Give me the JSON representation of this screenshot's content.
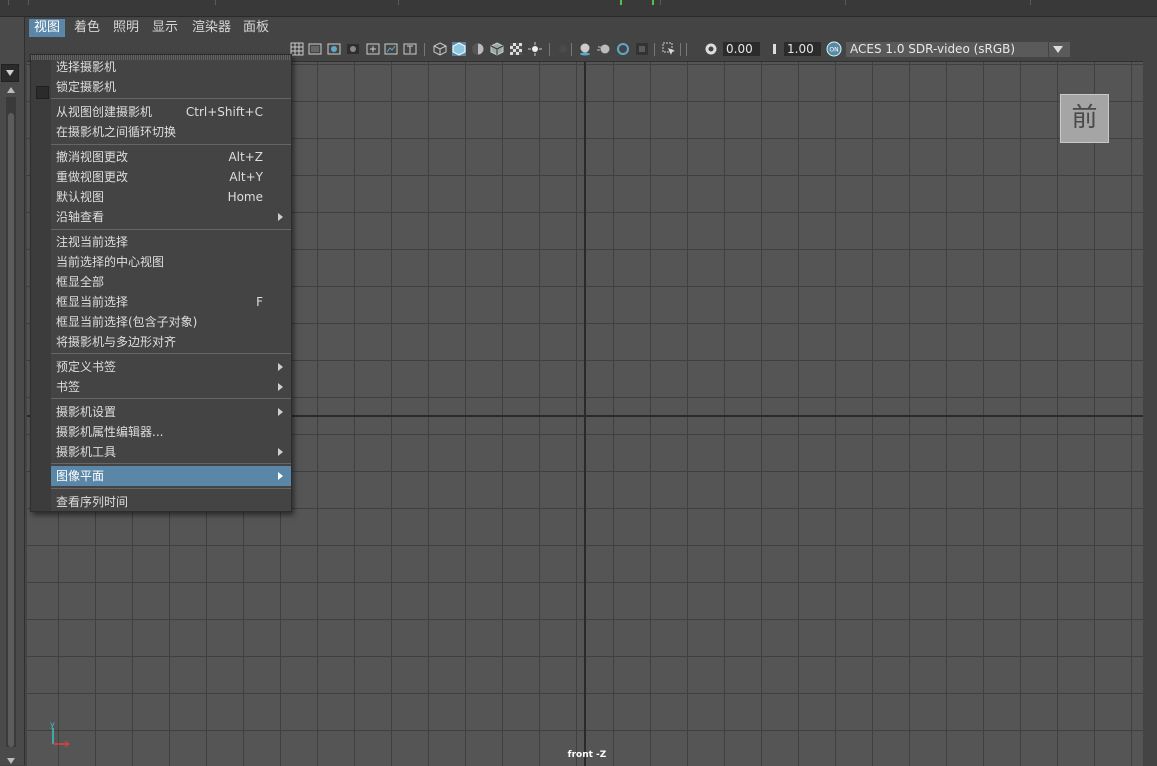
{
  "menubar": {
    "items": [
      "视图",
      "着色",
      "照明",
      "显示",
      "渲染器",
      "面板"
    ]
  },
  "toolbar": {
    "exposure": "0.00",
    "gamma": "1.00",
    "color_management": "ACES 1.0 SDR-video (sRGB)",
    "cm_icon": "on-badge-icon"
  },
  "viewport": {
    "viewcube_label": "前",
    "camera_label": "front -Z",
    "gizmo_y": "y"
  },
  "view_menu": {
    "items": [
      {
        "label": "选择摄影机",
        "shortcut": "",
        "submenu": false
      },
      {
        "label": "锁定摄影机",
        "shortcut": "",
        "submenu": false,
        "checkbox": true
      },
      {
        "label": "从视图创建摄影机",
        "shortcut": "Ctrl+Shift+C",
        "submenu": false
      },
      {
        "label": "在摄影机之间循环切换",
        "shortcut": "",
        "submenu": false
      },
      {
        "label": "撤消视图更改",
        "shortcut": "Alt+Z",
        "submenu": false
      },
      {
        "label": "重做视图更改",
        "shortcut": "Alt+Y",
        "submenu": false
      },
      {
        "label": "默认视图",
        "shortcut": "Home",
        "submenu": false
      },
      {
        "label": "沿轴查看",
        "shortcut": "",
        "submenu": true
      },
      {
        "label": "注视当前选择",
        "shortcut": "",
        "submenu": false
      },
      {
        "label": "当前选择的中心视图",
        "shortcut": "",
        "submenu": false
      },
      {
        "label": "框显全部",
        "shortcut": "",
        "submenu": false
      },
      {
        "label": "框显当前选择",
        "shortcut": "F",
        "submenu": false
      },
      {
        "label": "框显当前选择(包含子对象)",
        "shortcut": "",
        "submenu": false
      },
      {
        "label": "将摄影机与多边形对齐",
        "shortcut": "",
        "submenu": false
      },
      {
        "label": "预定义书签",
        "shortcut": "",
        "submenu": true
      },
      {
        "label": "书签",
        "shortcut": "",
        "submenu": true
      },
      {
        "label": "摄影机设置",
        "shortcut": "",
        "submenu": true
      },
      {
        "label": "摄影机属性编辑器...",
        "shortcut": "",
        "submenu": false
      },
      {
        "label": "摄影机工具",
        "shortcut": "",
        "submenu": true
      },
      {
        "label": "图像平面",
        "shortcut": "",
        "submenu": true,
        "highlighted": true
      },
      {
        "label": "查看序列时间",
        "shortcut": "",
        "submenu": false
      }
    ]
  },
  "colors": {
    "highlight": "#5a87a8",
    "menu_bg": "#444444",
    "grid_bg": "#555555",
    "grid_line": "#404040"
  }
}
